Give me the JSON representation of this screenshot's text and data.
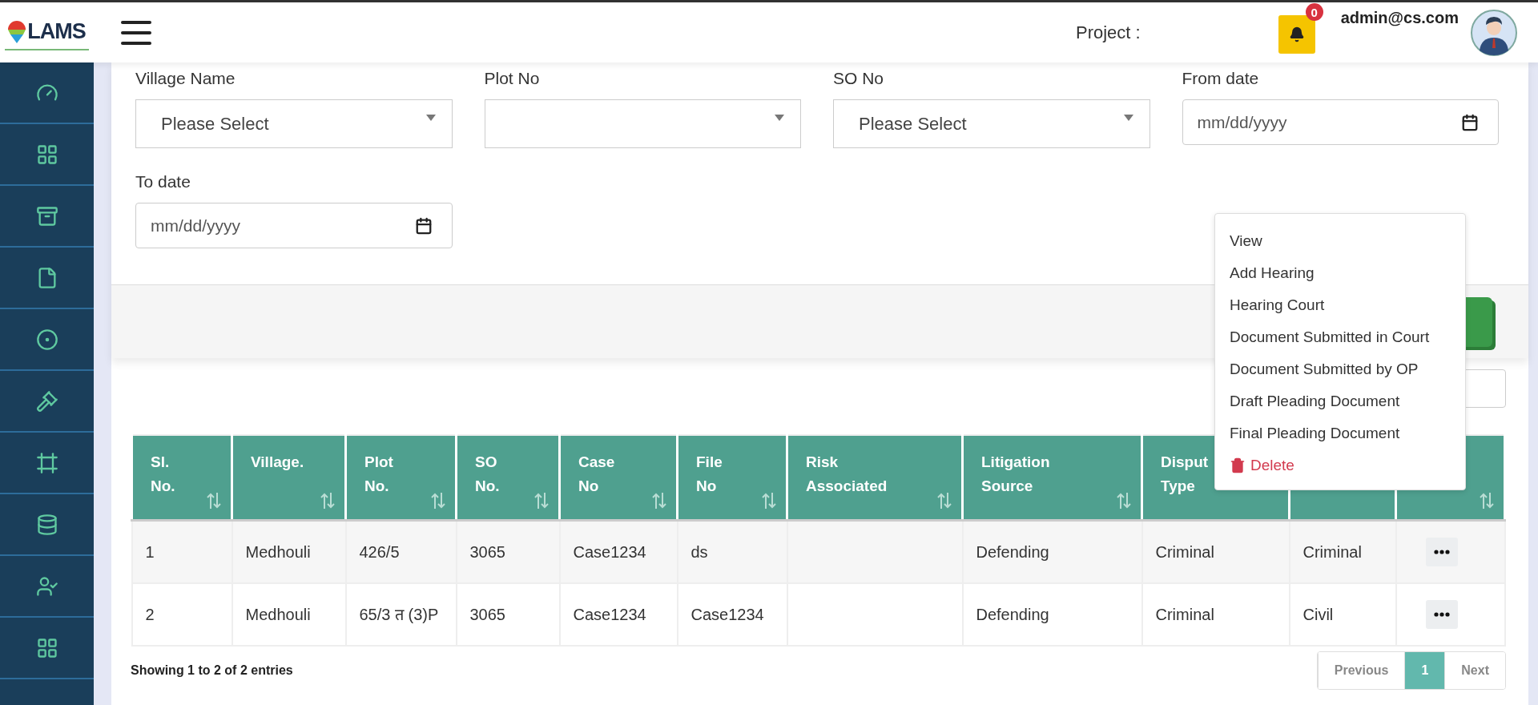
{
  "header": {
    "logo": "LAMS",
    "project_label": "Project :",
    "notifications": {
      "count": "0"
    },
    "user": "admin@cs.com"
  },
  "filters": [
    {
      "label": "Village Name",
      "kind": "select",
      "value": "Please Select"
    },
    {
      "label": "Plot No",
      "kind": "select"
    },
    {
      "label": "SO No",
      "kind": "select",
      "value": "Please Select"
    },
    {
      "label": "From date",
      "kind": "date",
      "placeholder": "mm/dd/yyyy"
    },
    {
      "label": "To date",
      "kind": "date",
      "placeholder": "mm/dd/yyyy"
    }
  ],
  "table": {
    "columns": [
      {
        "label": [
          "Sl.",
          "No."
        ],
        "sortable": true
      },
      {
        "label": [
          "Village."
        ],
        "sortable": true
      },
      {
        "label": [
          "Plot",
          "No."
        ],
        "sortable": true
      },
      {
        "label": [
          "SO",
          "No."
        ],
        "sortable": true
      },
      {
        "label": [
          "Case",
          "No"
        ],
        "sortable": true
      },
      {
        "label": [
          "File",
          "No"
        ],
        "sortable": true
      },
      {
        "label": [
          "Risk",
          "Associated"
        ],
        "sortable": true
      },
      {
        "label": [
          "Litigation",
          "Source"
        ],
        "sortable": true
      },
      {
        "label": [
          "Disput",
          "Type"
        ],
        "sortable": false
      },
      {
        "sortable": false
      },
      {
        "sortable": true
      }
    ],
    "rows": [
      [
        "1",
        "Medhouli",
        "426/5",
        "3065",
        "Case1234",
        "ds",
        "",
        "Defending",
        "Criminal",
        "Criminal"
      ],
      [
        "2",
        "Medhouli",
        "65/3 त (3)P",
        "3065",
        "Case1234",
        "Case1234",
        "",
        "Defending",
        "Criminal",
        "Civil"
      ]
    ]
  },
  "footer": {
    "info": "Showing 1 to 2 of 2 entries",
    "pagination": [
      {
        "label": "Previous",
        "selected": false
      },
      {
        "label": "1",
        "selected": true
      },
      {
        "label": "Next",
        "selected": false
      }
    ]
  },
  "menu": {
    "items": [
      {
        "label": "View",
        "kind": "plain"
      },
      {
        "label": "Add Hearing",
        "kind": "plain"
      },
      {
        "label": "Hearing Court",
        "kind": "plain"
      },
      {
        "label": "Document Submitted in Court",
        "kind": "plain"
      },
      {
        "label": "Document Submitted by OP",
        "kind": "plain"
      },
      {
        "label": "Draft Pleading Document",
        "kind": "plain"
      },
      {
        "label": "Final Pleading Document",
        "kind": "plain"
      },
      {
        "label": "Delete",
        "kind": "danger"
      }
    ]
  }
}
